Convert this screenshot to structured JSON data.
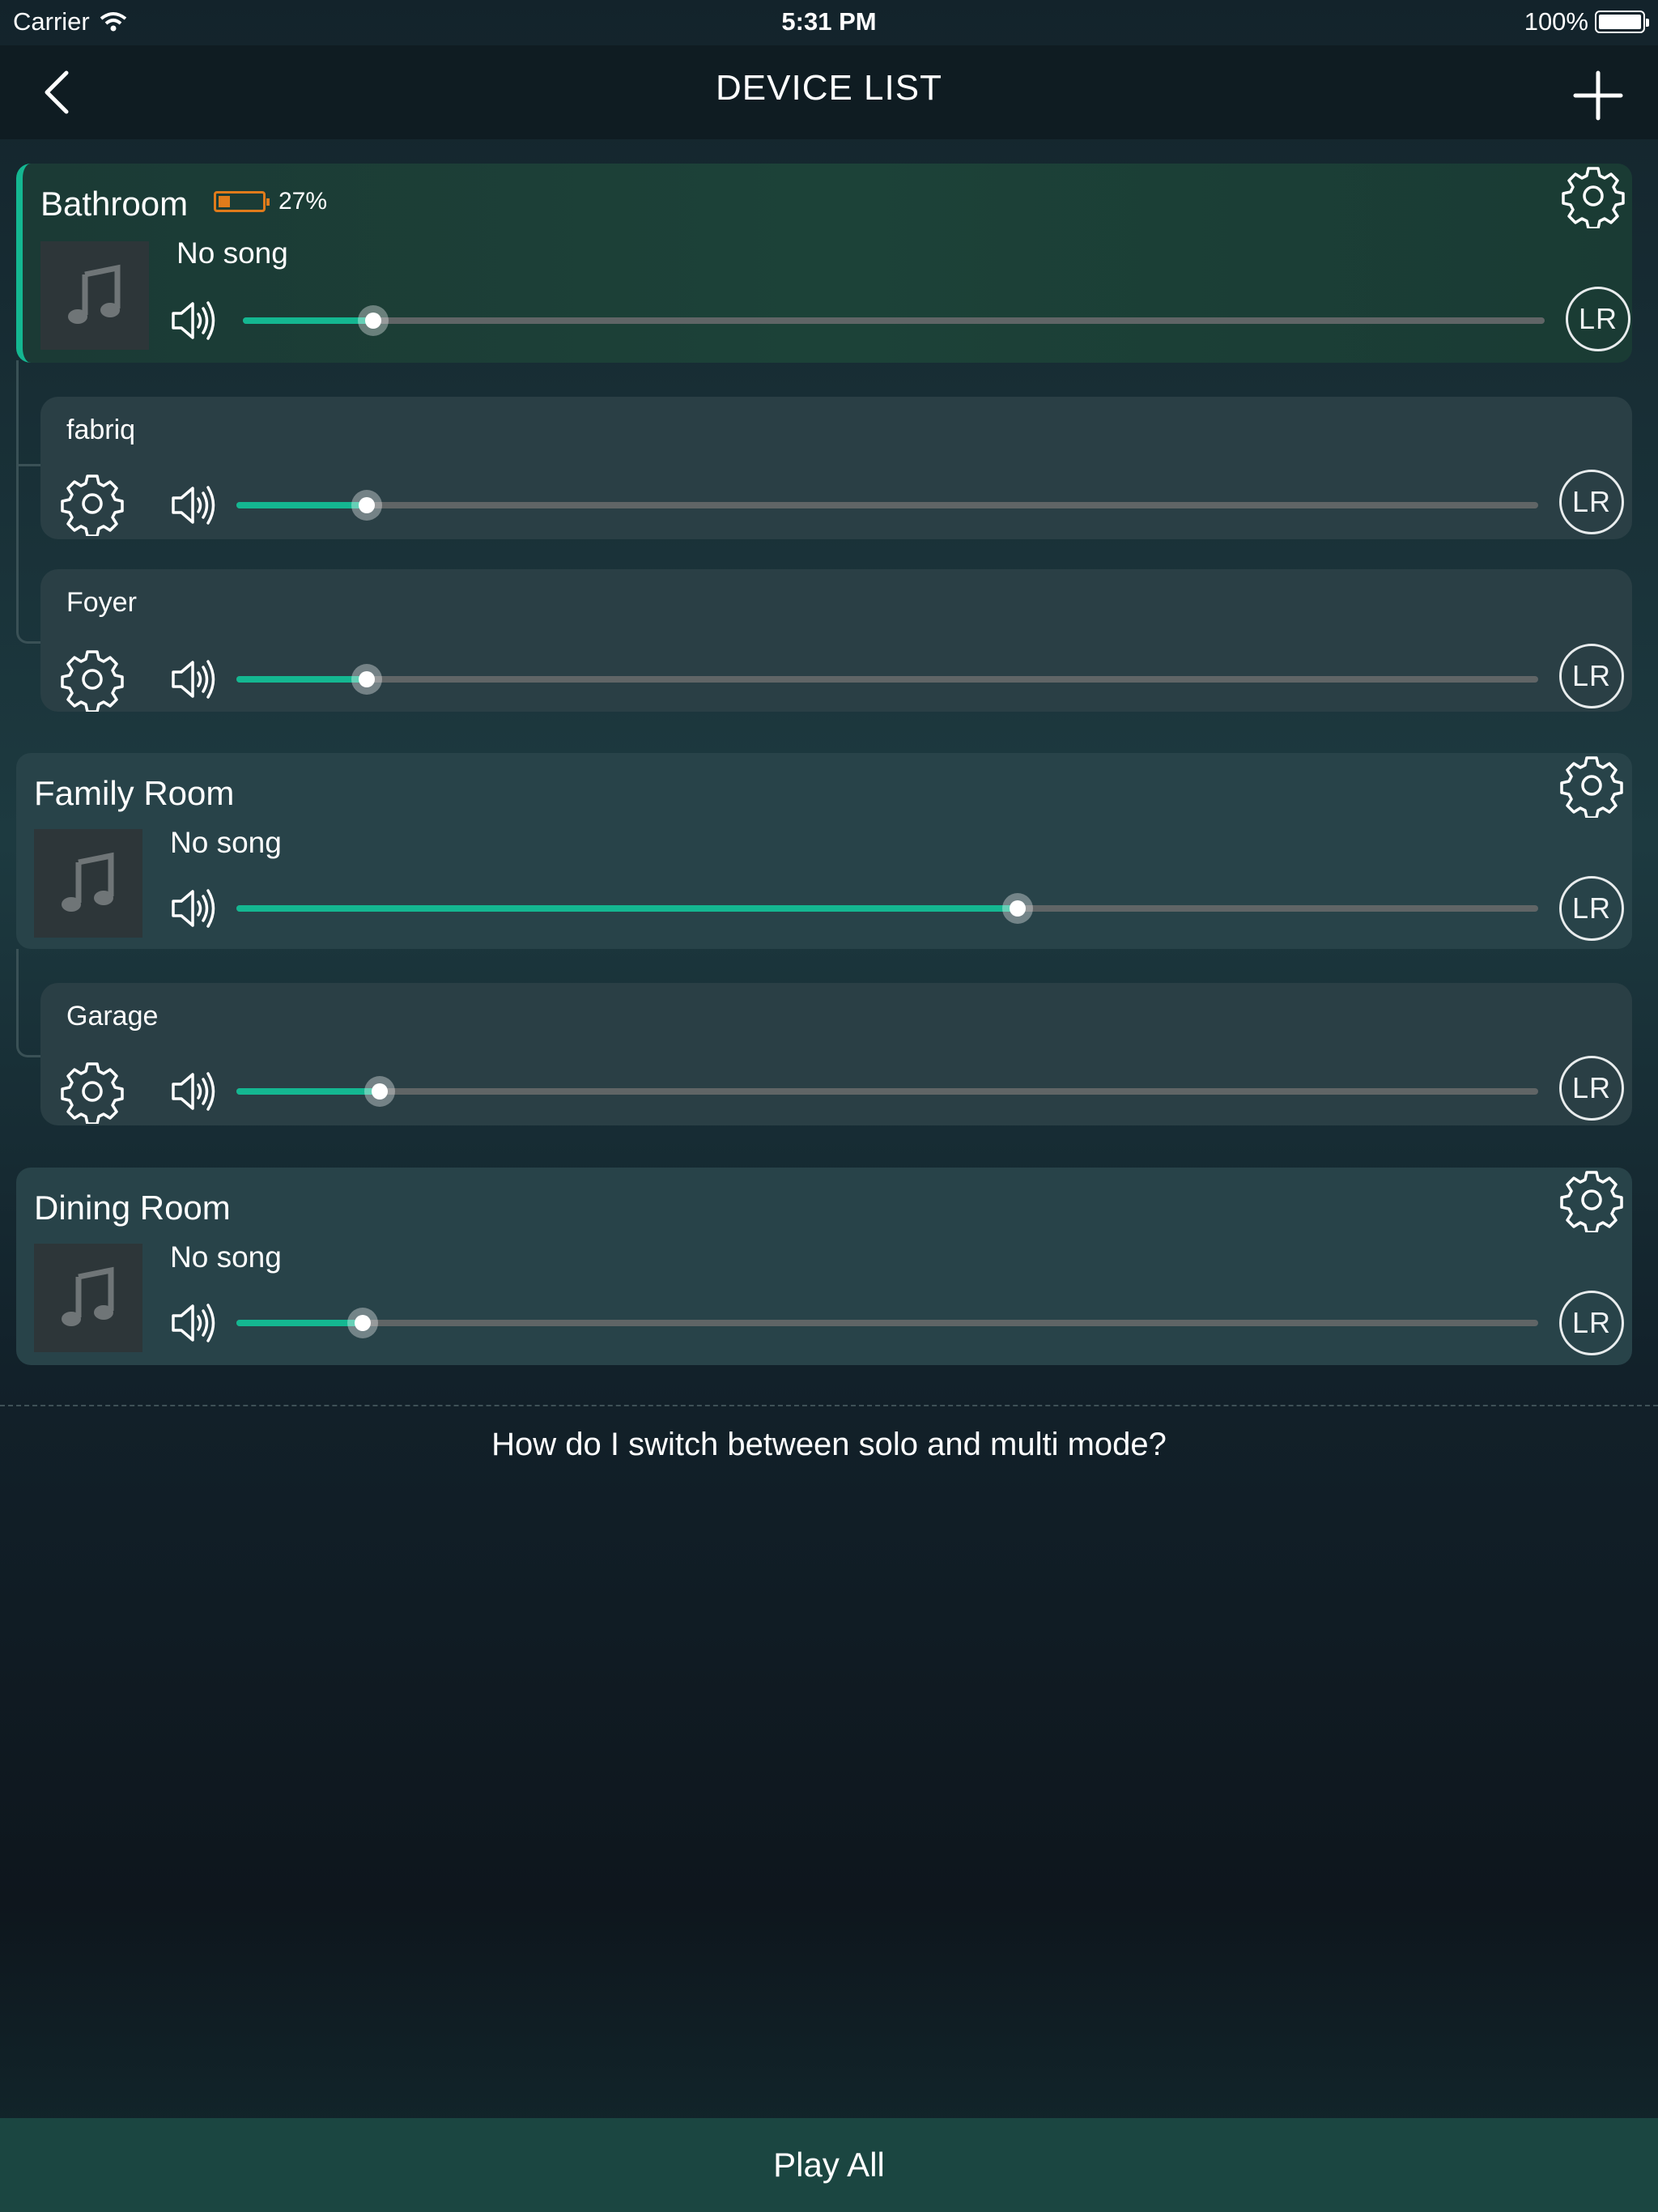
{
  "status_bar": {
    "carrier": "Carrier",
    "time": "5:31 PM",
    "battery": "100%"
  },
  "nav": {
    "title": "DEVICE LIST",
    "back_icon": "chevron-left-icon",
    "add_icon": "plus-icon"
  },
  "groups": [
    {
      "master": {
        "name": "Bathroom",
        "battery_percent": "27%",
        "battery_level": 0.27,
        "song": "No song",
        "volume": 0.1,
        "channel": "LR",
        "selected": true
      },
      "members": [
        {
          "name": "fabriq",
          "volume": 0.1,
          "channel": "LR"
        },
        {
          "name": "Foyer",
          "volume": 0.1,
          "channel": "LR"
        }
      ]
    },
    {
      "master": {
        "name": "Family Room",
        "song": "No song",
        "volume": 0.6,
        "channel": "LR"
      },
      "members": [
        {
          "name": "Garage",
          "volume": 0.11,
          "channel": "LR"
        }
      ]
    },
    {
      "master": {
        "name": "Dining Room",
        "song": "No song",
        "volume": 0.097,
        "channel": "LR"
      },
      "members": []
    }
  ],
  "help_link": "How do I switch between solo and multi mode?",
  "footer": {
    "play_all": "Play All"
  },
  "colors": {
    "accent": "#14b791",
    "battery_low": "#e07b1b",
    "footer_bg": "#1b4641"
  }
}
